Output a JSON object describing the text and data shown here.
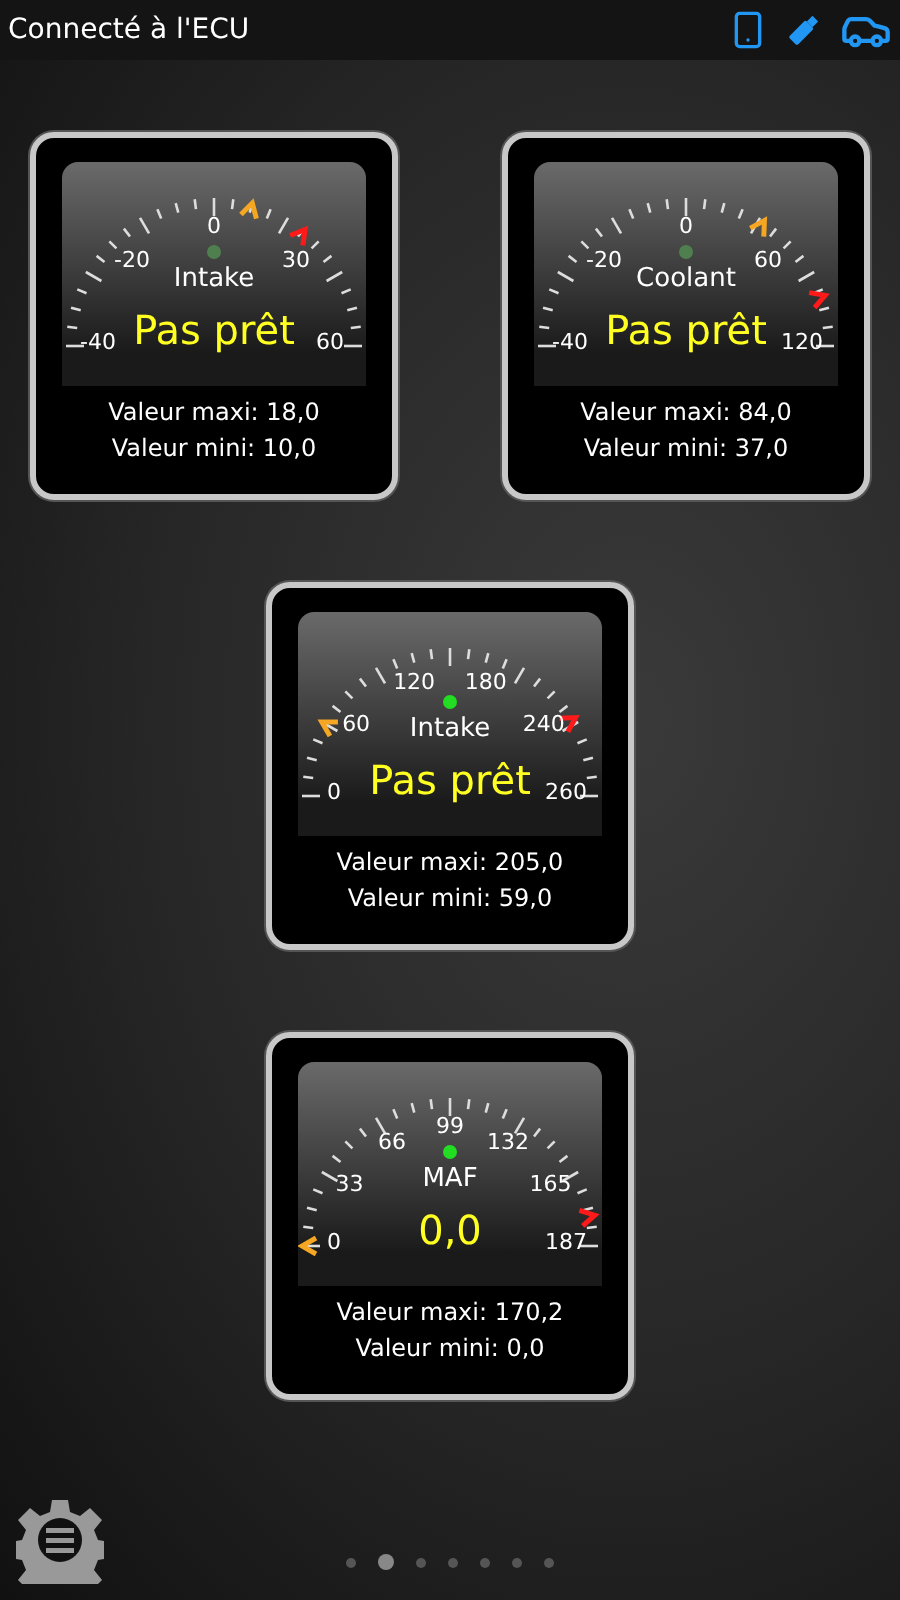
{
  "status_bar": {
    "title": "Connecté à l'ECU"
  },
  "gauges": [
    {
      "title": "Intake",
      "value": "Pas prêt",
      "scale": [
        "-40",
        "-20",
        "0",
        "30",
        "60"
      ],
      "indicator_on": false,
      "stats": [
        "Valeur maxi: 18,0",
        "Valeur mini: 10,0"
      ]
    },
    {
      "title": "Coolant",
      "value": "Pas prêt",
      "scale": [
        "-40",
        "-20",
        "0",
        "60",
        "120"
      ],
      "indicator_on": false,
      "stats": [
        "Valeur maxi: 84,0",
        "Valeur mini: 37,0"
      ]
    },
    {
      "title": "Intake",
      "value": "Pas prêt",
      "scale": [
        "0",
        "60",
        "120",
        "180",
        "240",
        "260"
      ],
      "indicator_on": true,
      "stats": [
        "Valeur maxi: 205,0",
        "Valeur mini: 59,0"
      ]
    },
    {
      "title": "MAF",
      "value": "0,0",
      "scale": [
        "0",
        "33",
        "66",
        "99",
        "132",
        "165",
        "187"
      ],
      "indicator_on": true,
      "stats": [
        "Valeur maxi: 170,2",
        "Valeur mini: 0,0"
      ]
    }
  ],
  "pages": [
    {
      "selected": false
    },
    {
      "selected": true
    },
    {
      "selected": false
    },
    {
      "selected": false
    },
    {
      "selected": false
    },
    {
      "selected": false
    },
    {
      "selected": false
    }
  ]
}
